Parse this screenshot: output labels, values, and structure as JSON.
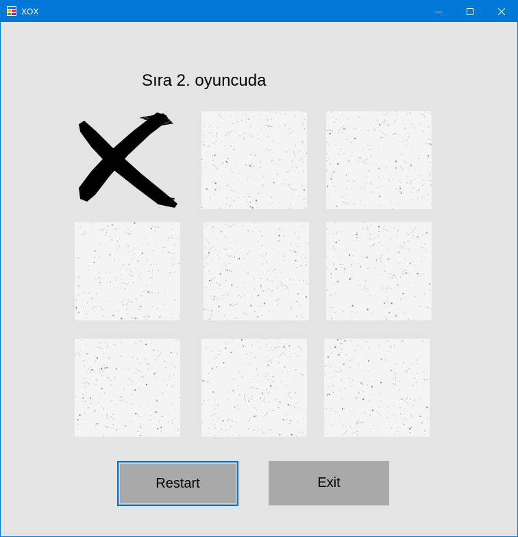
{
  "window": {
    "title": "XOX",
    "accent": "#0078d7",
    "controls": [
      "minimize-icon",
      "maximize-icon",
      "close-icon"
    ]
  },
  "game": {
    "status": "Sıra 2. oyuncuda",
    "board": [
      [
        "X",
        "",
        ""
      ],
      [
        "",
        "",
        ""
      ],
      [
        "",
        "",
        ""
      ]
    ]
  },
  "buttons": {
    "restart_label": "Restart",
    "exit_label": "Exit"
  }
}
